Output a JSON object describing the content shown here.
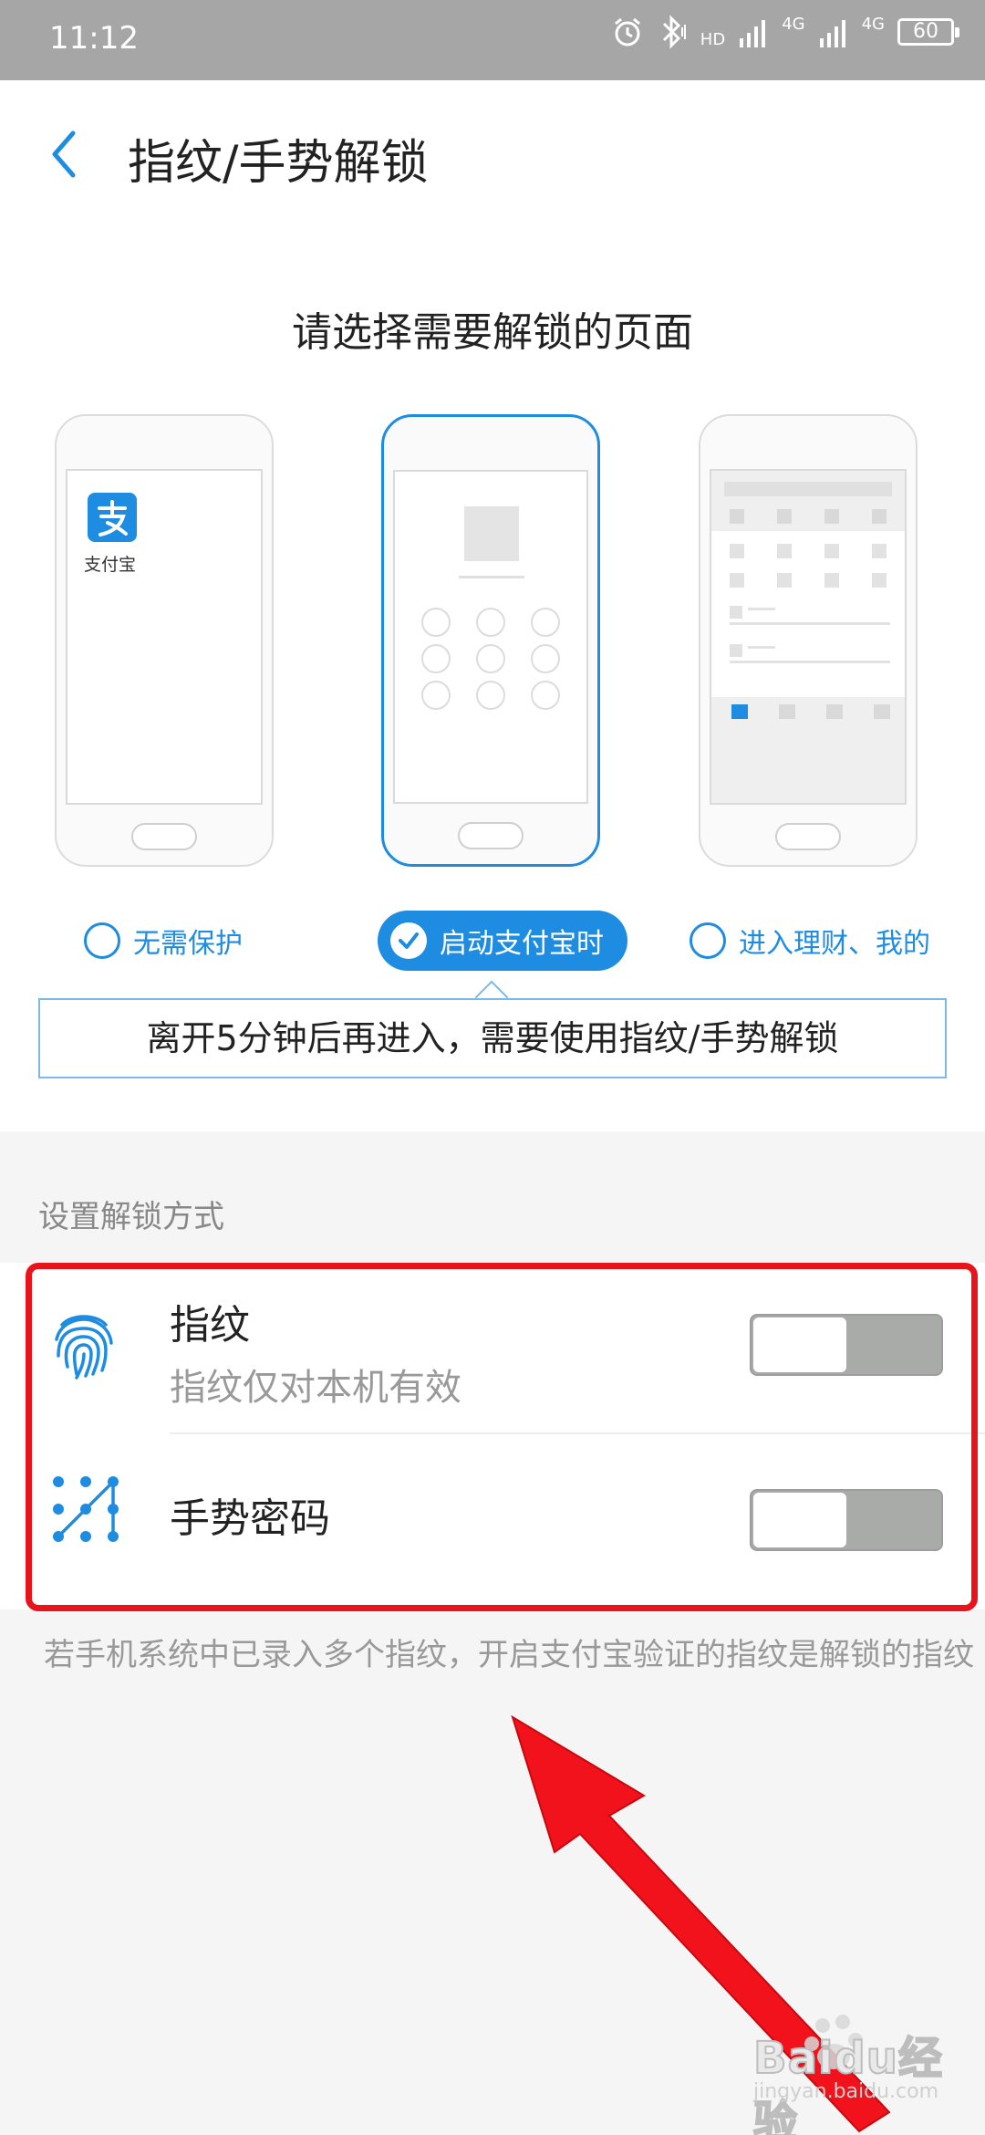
{
  "status_bar": {
    "time": "11:12",
    "battery": "60",
    "network_labels": [
      "HD",
      "4G",
      "4G"
    ]
  },
  "header": {
    "title": "指纹/手势解锁"
  },
  "page_selection": {
    "prompt": "请选择需要解锁的页面",
    "preview_app_label": "支付宝",
    "options": [
      {
        "label": "无需保护",
        "selected": false
      },
      {
        "label": "启动支付宝时",
        "selected": true
      },
      {
        "label": "进入理财、我的",
        "selected": false
      }
    ],
    "info": "离开5分钟后再进入，需要使用指纹/手势解锁"
  },
  "unlock_methods": {
    "header": "设置解锁方式",
    "items": [
      {
        "title": "指纹",
        "subtitle": "指纹仅对本机有效",
        "enabled": false,
        "icon": "fingerprint-icon"
      },
      {
        "title": "手势密码",
        "enabled": false,
        "icon": "gesture-pattern-icon"
      }
    ],
    "footnote": "若手机系统中已录入多个指纹，开启支付宝验证的指纹是解锁的指纹"
  },
  "watermark": {
    "text": "Baidu经验",
    "url": "jingyan.baidu.com"
  },
  "colors": {
    "accent": "#1e8ce1",
    "highlight": "#e8141b",
    "toggle_off": "#a9aba9"
  }
}
